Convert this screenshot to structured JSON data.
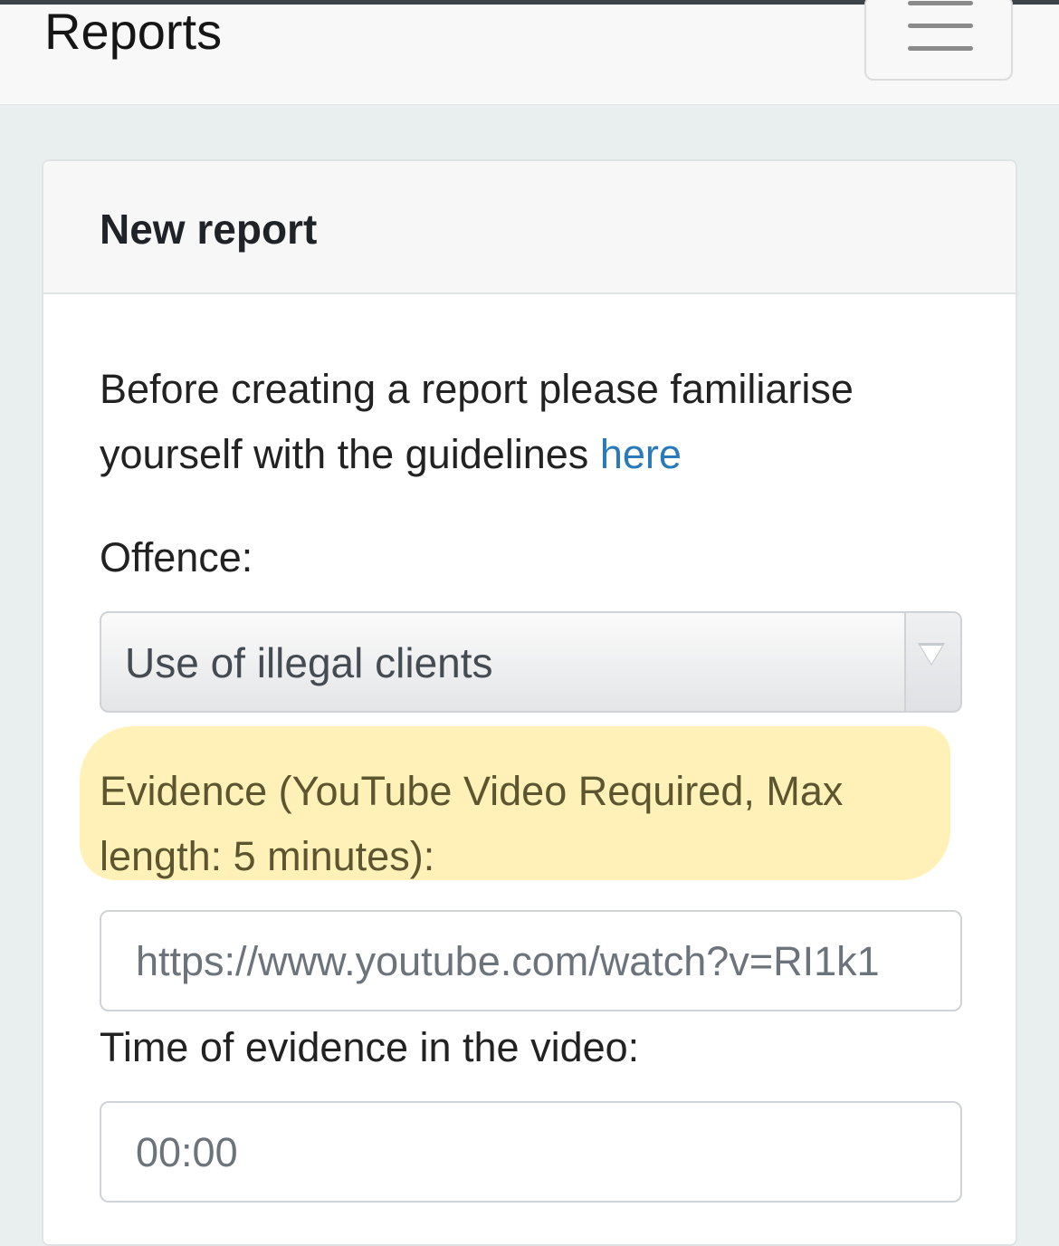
{
  "navbar": {
    "brand": "Reports",
    "menu_icon": "hamburger-menu-icon"
  },
  "card": {
    "title": "New report",
    "intro_text": "Before creating a report please familiarise yourself with the guidelines ",
    "intro_link": "here"
  },
  "form": {
    "offence_label": "Offence:",
    "offence_value": "Use of illegal clients",
    "evidence_label": "Evidence (YouTube Video Required, Max length: 5 minutes):",
    "evidence_value": "https://www.youtube.com/watch?v=RI1k1",
    "time_label": "Time of evidence in the video:",
    "time_placeholder": "00:00"
  },
  "colors": {
    "link": "#2a7ab9",
    "highlight": "#fff0b3",
    "navbar_bg": "#f8f8f8",
    "page_bg": "#e9eeee"
  }
}
